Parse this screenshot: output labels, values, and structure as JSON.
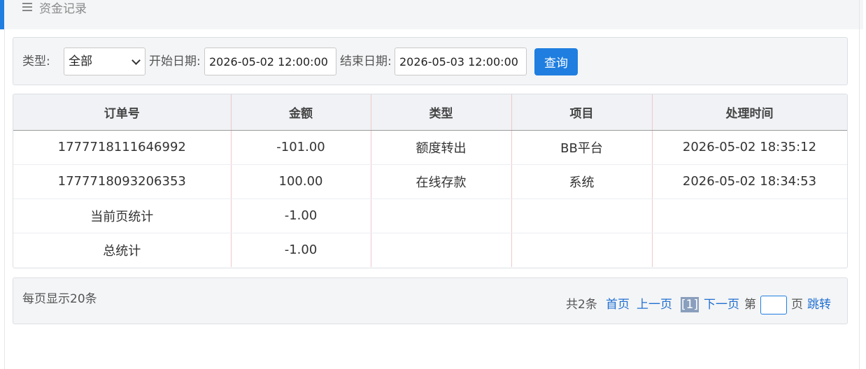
{
  "header": {
    "title": "资金记录",
    "icon": "hamburger-menu-icon"
  },
  "filters": {
    "type_label": "类型:",
    "type_value": "全部",
    "start_label": "开始日期:",
    "start_value": "2026-05-02 12:00:00",
    "end_label": "结束日期:",
    "end_value": "2026-05-03 12:00:00",
    "query_button": "查询"
  },
  "table": {
    "columns": [
      "订单号",
      "金额",
      "类型",
      "项目",
      "处理时间"
    ],
    "rows": [
      [
        "1777718111646992",
        "-101.00",
        "额度转出",
        "BB平台",
        "2026-05-02 18:35:12"
      ],
      [
        "1777718093206353",
        "100.00",
        "在线存款",
        "系统",
        "2026-05-02 18:34:53"
      ],
      [
        "当前页统计",
        "-1.00",
        "",
        "",
        ""
      ],
      [
        "总统计",
        "-1.00",
        "",
        "",
        ""
      ]
    ]
  },
  "pagination": {
    "per_page": "每页显示20条",
    "total": "共2条",
    "first": "首页",
    "prev": "上一页",
    "current": "[1]",
    "next": "下一页",
    "page_prefix": "第",
    "page_suffix": "页",
    "jump": "跳转"
  },
  "colors": {
    "accent": "#1f7ee0",
    "link": "#1f6fd0"
  }
}
